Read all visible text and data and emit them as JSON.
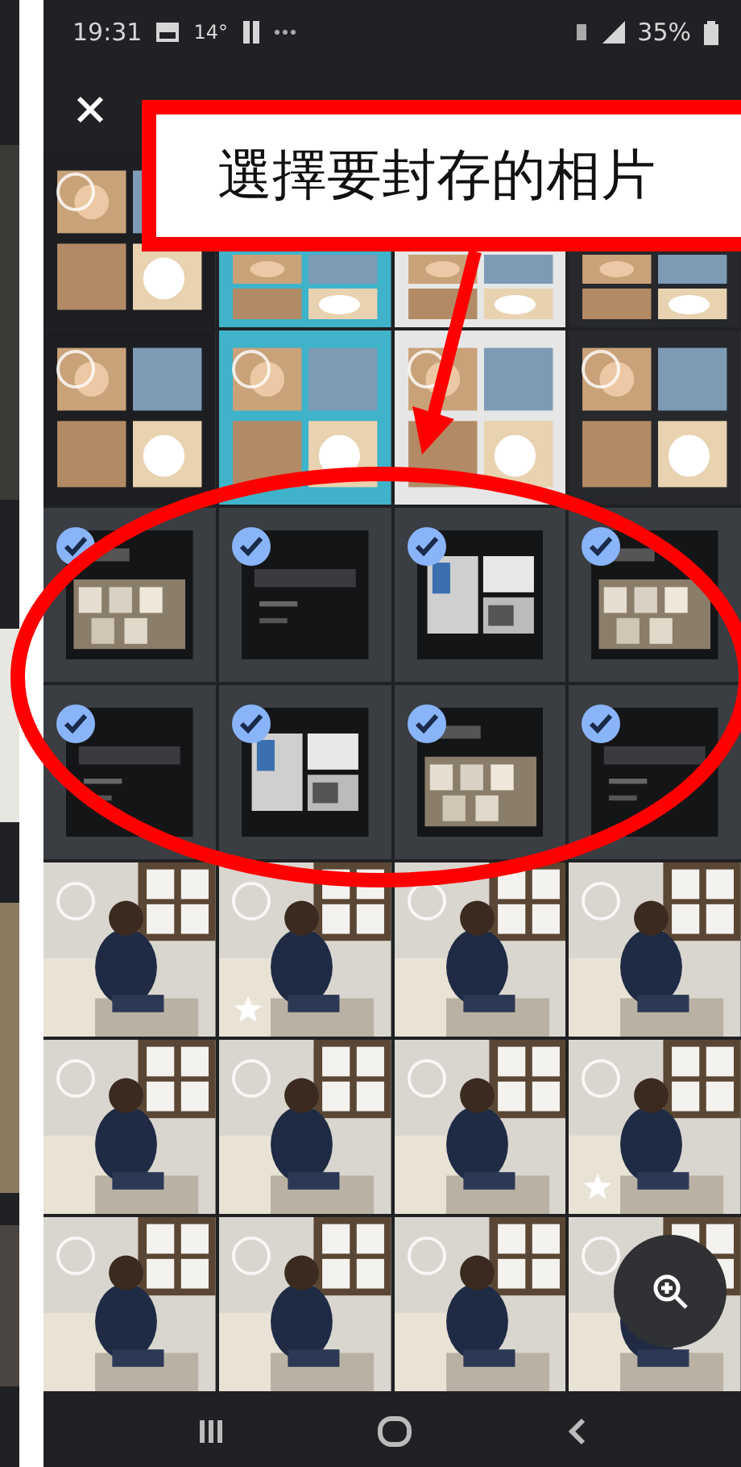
{
  "status_bar": {
    "time": "19:31",
    "temperature": "14°",
    "battery": "35%"
  },
  "callout": {
    "text": "選擇要封存的相片"
  },
  "grid": {
    "rows": [
      [
        {
          "selected": false,
          "favorite": false
        },
        {},
        {},
        {}
      ],
      [
        {
          "selected": false,
          "favorite": false
        },
        {
          "selected": false,
          "favorite": false
        },
        {
          "selected": false,
          "favorite": false
        },
        {
          "selected": false,
          "favorite": false
        }
      ],
      [
        {
          "selected": true,
          "favorite": false
        },
        {
          "selected": true,
          "favorite": false
        },
        {
          "selected": true,
          "favorite": false
        },
        {
          "selected": true,
          "favorite": false
        }
      ],
      [
        {
          "selected": true,
          "favorite": false
        },
        {
          "selected": true,
          "favorite": false
        },
        {
          "selected": true,
          "favorite": false
        },
        {
          "selected": true,
          "favorite": false
        }
      ],
      [
        {
          "selected": false,
          "favorite": false
        },
        {
          "selected": false,
          "favorite": true
        },
        {
          "selected": false,
          "favorite": false
        },
        {
          "selected": false,
          "favorite": false
        }
      ],
      [
        {
          "selected": false,
          "favorite": false
        },
        {
          "selected": false,
          "favorite": false
        },
        {
          "selected": false,
          "favorite": false
        },
        {
          "selected": false,
          "favorite": true
        }
      ],
      [
        {
          "selected": false,
          "favorite": false
        },
        {
          "selected": false,
          "favorite": false
        },
        {
          "selected": false,
          "favorite": false
        },
        {
          "selected": false,
          "favorite": false
        }
      ]
    ]
  }
}
